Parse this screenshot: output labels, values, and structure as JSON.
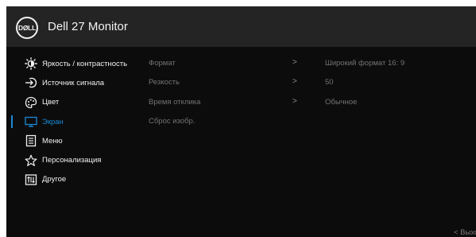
{
  "header": {
    "logo": "DØLL",
    "title": "Dell 27 Monitor"
  },
  "menu": {
    "items": [
      {
        "label": "Яркость / контрастность",
        "icon": "brightness-icon"
      },
      {
        "label": "Источник сигнала",
        "icon": "input-source-icon"
      },
      {
        "label": "Цвет",
        "icon": "color-palette-icon"
      },
      {
        "label": "Экран",
        "icon": "display-icon"
      },
      {
        "label": "Меню",
        "icon": "menu-icon"
      },
      {
        "label": "Персонализация",
        "icon": "star-icon"
      },
      {
        "label": "Другое",
        "icon": "other-icon"
      }
    ],
    "active_color": "#1a8ad6"
  },
  "display_settings": {
    "rows": [
      {
        "label": "Формат",
        "arrow": ">",
        "value": "Широкий формат 16: 9"
      },
      {
        "label": "Резкость",
        "arrow": ">",
        "value": "50"
      },
      {
        "label": "Время отклика",
        "arrow": ">",
        "value": "Обычное"
      },
      {
        "label": "Сброс изобр.",
        "arrow": "",
        "value": ""
      }
    ]
  },
  "footer": {
    "exit_label": "<  Выход"
  }
}
